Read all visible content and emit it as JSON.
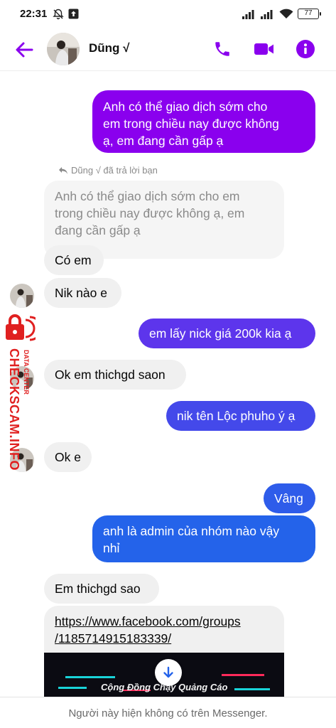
{
  "status_bar": {
    "time": "22:31",
    "battery": "77"
  },
  "header": {
    "contact_name": "Dũng √"
  },
  "reply_note": "Dũng √ đã trả lời bạn",
  "messages": [
    {
      "id": "m1",
      "side": "sent",
      "color": "#8a00ee",
      "lines": [
        "Anh có thể giao dịch sớm cho",
        "em trong chiều nay được không",
        "ạ, em đang cần gấp ạ"
      ]
    },
    {
      "id": "m2",
      "side": "quoted",
      "lines": [
        "Anh có thể giao dịch sớm cho em",
        "trong chiều nay được không ạ, em",
        "đang cần gấp ạ"
      ]
    },
    {
      "id": "m3",
      "side": "received",
      "lines": [
        "Có em"
      ]
    },
    {
      "id": "m4",
      "side": "received",
      "lines": [
        "Nik nào e"
      ]
    },
    {
      "id": "m5",
      "side": "sent",
      "color": "#5d35ec",
      "lines": [
        "em lấy nick giá 200k kia ạ"
      ]
    },
    {
      "id": "m6",
      "side": "received",
      "lines": [
        "Ok em thichgd saon"
      ]
    },
    {
      "id": "m7",
      "side": "sent",
      "color": "#4449ea",
      "lines": [
        "nik tên Lộc phuho ý ạ"
      ]
    },
    {
      "id": "m8",
      "side": "received",
      "lines": [
        "Ok e"
      ]
    },
    {
      "id": "m9",
      "side": "sent",
      "color": "#2e5cea",
      "lines": [
        "Vâng"
      ]
    },
    {
      "id": "m10",
      "side": "sent",
      "color": "#2463ea",
      "lines": [
        "anh là admin của nhóm nào vậy",
        "nhỉ"
      ]
    },
    {
      "id": "m11",
      "side": "received",
      "lines": [
        "Em thichgd sao"
      ]
    },
    {
      "id": "m12",
      "side": "received",
      "link": true,
      "lines": [
        "https://www.facebook.com/groups",
        "/1185714915183339/"
      ]
    }
  ],
  "link_preview": {
    "text": "Cộng Đồng Chạy Quảng Cáo"
  },
  "watermark": {
    "brand": "CHECKSCAM.INFO",
    "caption": "DATA CENTER"
  },
  "footer": {
    "notice": "Người này hiện không có trên Messenger."
  },
  "colors": {
    "accent": "#8a00ee",
    "sent_blue": "#2463ea",
    "received_bg": "#f0f0f0",
    "watermark_red": "#e02020"
  }
}
